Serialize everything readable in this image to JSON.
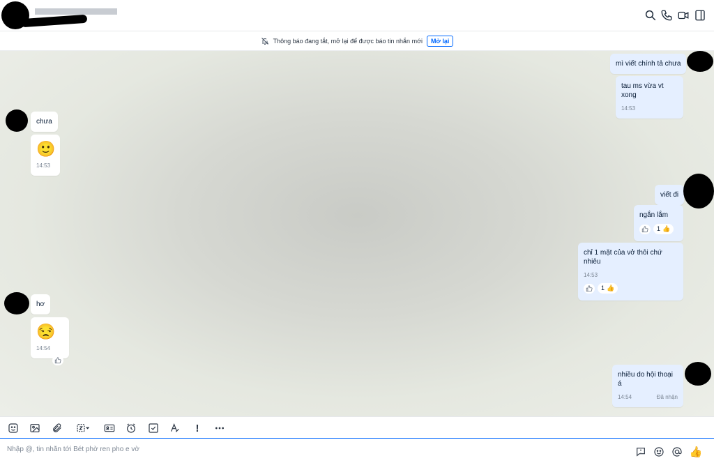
{
  "notice": {
    "text": "Thông báo đang tắt, mở lại để được báo tin nhắn mới",
    "button": "Mở lại"
  },
  "header": {
    "icons": [
      "search-icon",
      "phone-icon",
      "video-call-icon",
      "sidebar-toggle-icon"
    ]
  },
  "messages": [
    {
      "side": "out",
      "text": "mì viết chính tả chưa"
    },
    {
      "side": "out",
      "text": "tau ms vừa vt xong",
      "time": "14:53"
    },
    {
      "side": "in",
      "text": "chưa"
    },
    {
      "side": "in",
      "emoji": "🙂",
      "time": "14:53"
    },
    {
      "side": "out",
      "text": "viết đi"
    },
    {
      "side": "out",
      "text": "ngắn lắm",
      "reaction_count": "1"
    },
    {
      "side": "out",
      "text": "chỉ 1 mặt của vở thôi chứ nhiêu",
      "time": "14:53",
      "reaction_count": "1"
    },
    {
      "side": "in",
      "text": "hơ"
    },
    {
      "side": "in",
      "emoji": "😒",
      "time": "14:54"
    },
    {
      "side": "out",
      "text": "nhiều do hội thoại á",
      "time": "14:54",
      "status": "Đã nhận"
    }
  ],
  "toolbar": {
    "icons": [
      "sticker-icon",
      "image-icon",
      "attachment-icon",
      "screenshot-icon",
      "contact-card-icon",
      "reminder-icon",
      "task-icon",
      "text-format-icon",
      "urgent-icon",
      "more-icon"
    ]
  },
  "composer": {
    "placeholder": "Nhập @, tin nhắn tới Bét phờ ren pho e vờ",
    "icons": [
      "quick-message-icon",
      "emoji-icon",
      "mention-icon",
      "like-icon"
    ]
  },
  "colors": {
    "accent": "#0068ff",
    "outgoing_bubble": "#e5efff",
    "incoming_bubble": "#ffffff"
  }
}
